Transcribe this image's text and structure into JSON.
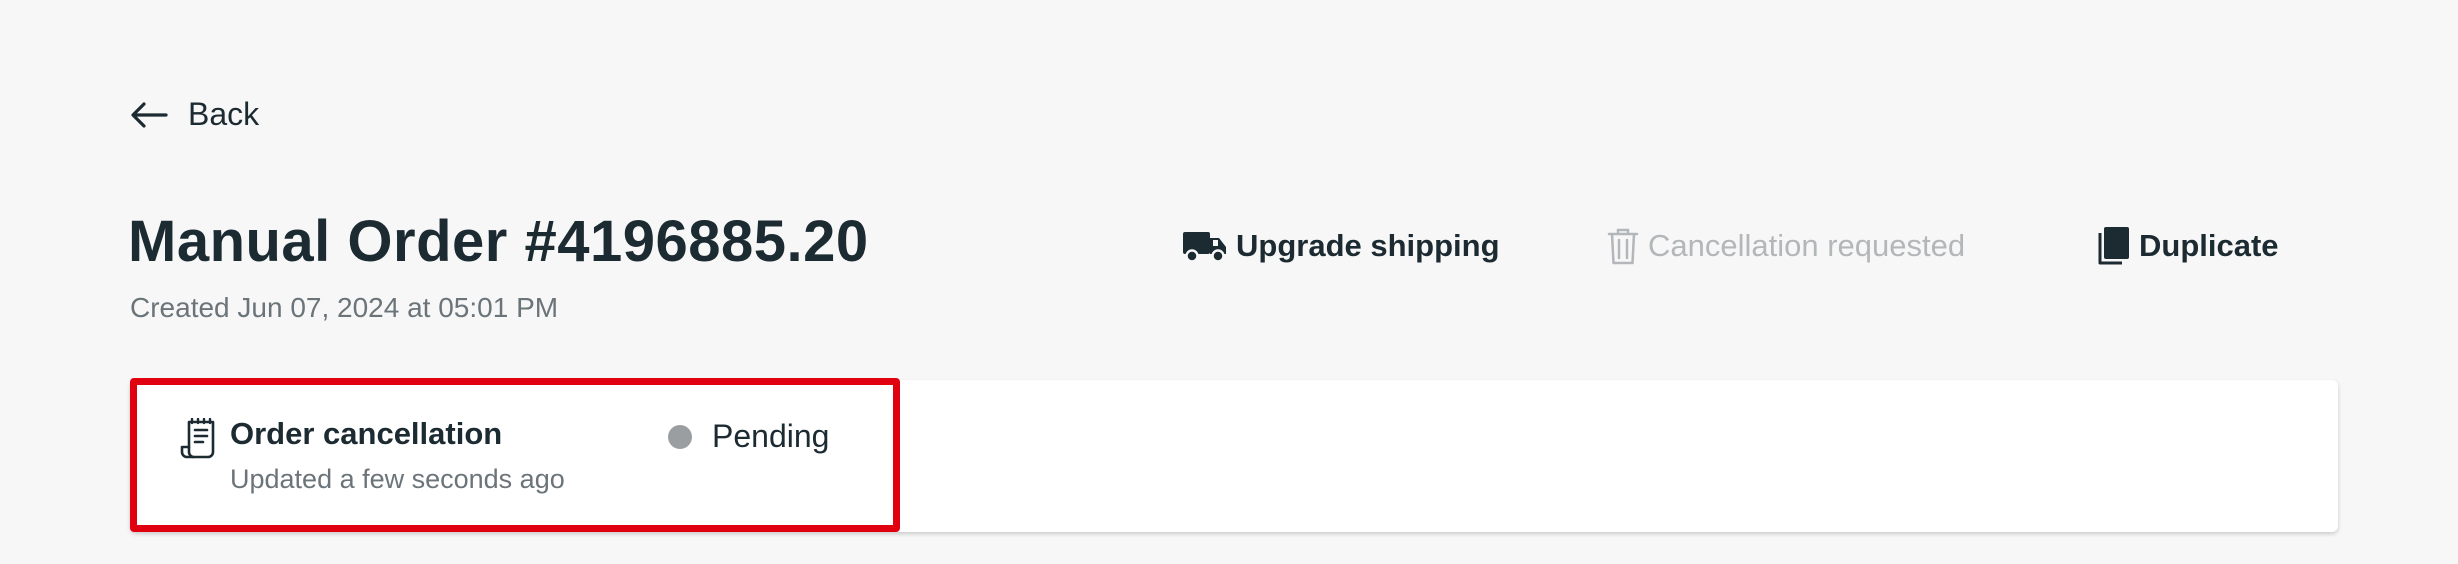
{
  "nav": {
    "back_label": "Back"
  },
  "order": {
    "title": "Manual Order #4196885.20",
    "created": "Created Jun 07, 2024 at 05:01 PM"
  },
  "actions": {
    "upgrade_shipping": "Upgrade shipping",
    "cancellation_requested": "Cancellation requested",
    "duplicate": "Duplicate"
  },
  "status_card": {
    "title": "Order cancellation",
    "updated": "Updated a few seconds ago",
    "status": "Pending"
  },
  "icons": {
    "back": "arrow-left-icon",
    "upgrade_shipping": "truck-icon",
    "cancellation": "trash-icon",
    "duplicate": "copy-icon",
    "status_card": "receipt-icon"
  },
  "colors": {
    "text_primary": "#1c2a32",
    "text_secondary": "#6b7479",
    "disabled": "#b3b7ba",
    "highlight": "#e0000f",
    "status_dot": "#9a9ea1",
    "background": "#f7f7f7",
    "card": "#ffffff"
  }
}
